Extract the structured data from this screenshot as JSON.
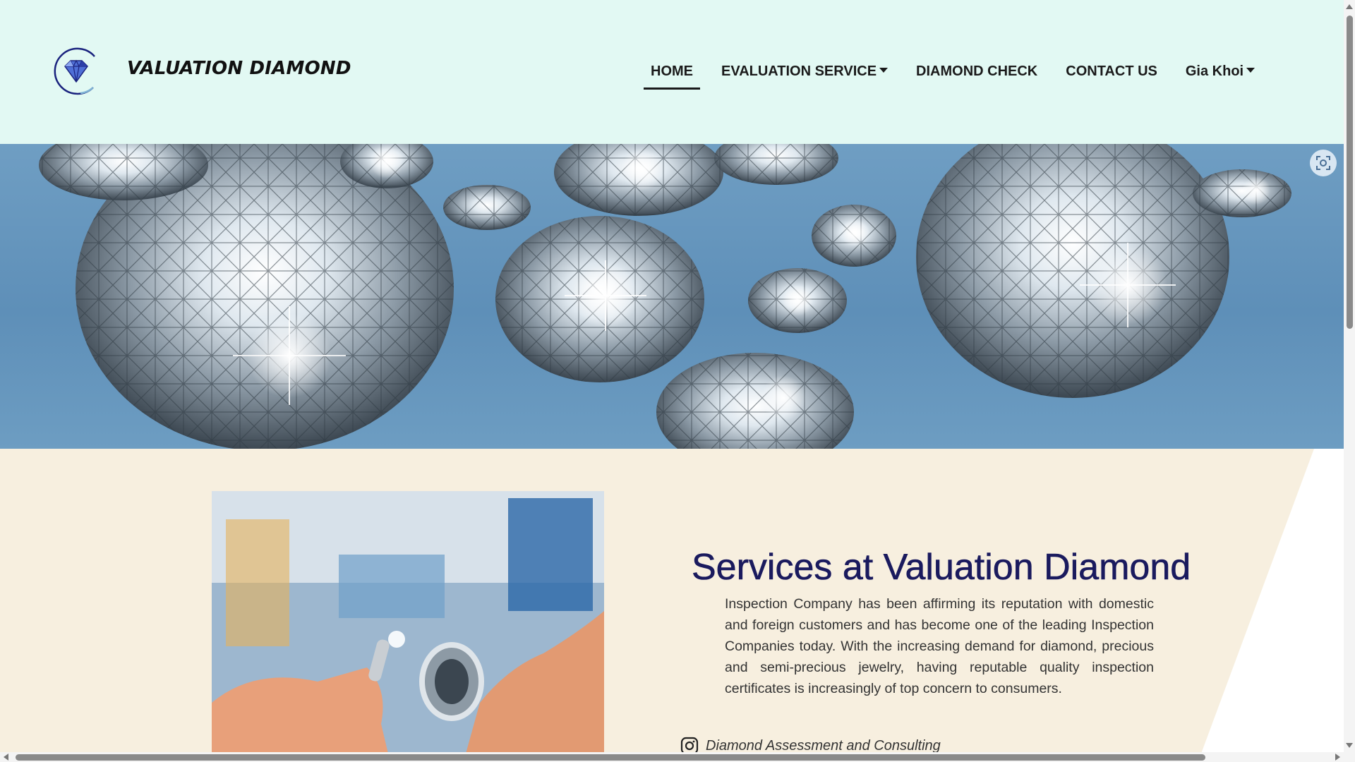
{
  "header": {
    "brand": "VALUATION DIAMOND",
    "logo_icon": "diamond-icon",
    "nav": [
      {
        "label": "HOME",
        "active": true,
        "dropdown": false
      },
      {
        "label": "EVALUATION SERVICE",
        "active": false,
        "dropdown": true
      },
      {
        "label": "DIAMOND CHECK",
        "active": false,
        "dropdown": false
      },
      {
        "label": "CONTACT US",
        "active": false,
        "dropdown": false
      },
      {
        "label": "Gia Khoi",
        "active": false,
        "dropdown": true
      }
    ]
  },
  "hero": {
    "image": "diamonds-banner",
    "action_icon": "screen-capture-icon"
  },
  "services": {
    "title": "Services at Valuation Diamond",
    "description": "Inspection Company has been affirming its reputation with domestic and foreign customers and has become one of the leading Inspection Companies today. With the increasing demand for diamond, precious and semi-precious jewelry, having reputable quality inspection certificates is increasingly of top concern to consumers.",
    "items": [
      {
        "icon": "instagram-icon",
        "label": "Diamond Assessment and Consulting"
      }
    ]
  },
  "colors": {
    "header_bg": "#e2f9f3",
    "section_bg": "#f7efdf",
    "title": "#1a1a5e",
    "logo_ring": "#1a237e"
  }
}
